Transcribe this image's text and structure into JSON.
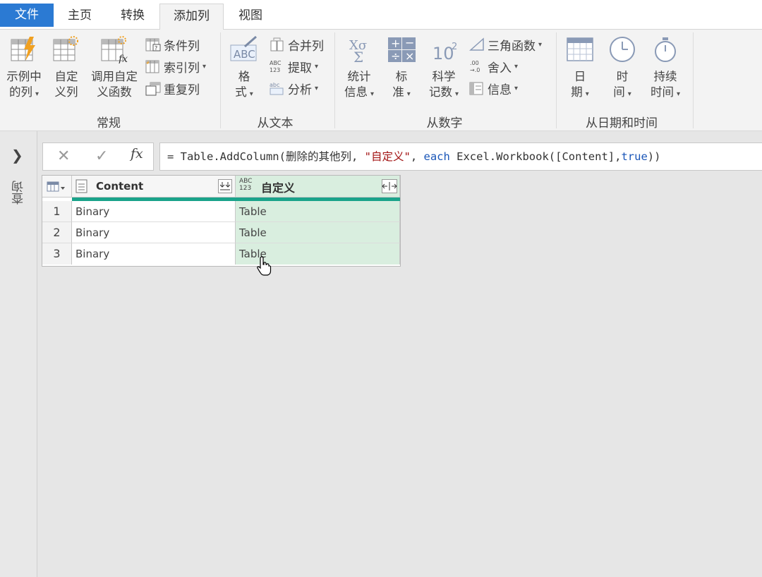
{
  "menu": {
    "file": "文件",
    "home": "主页",
    "transform": "转换",
    "add_column": "添加列",
    "view": "视图"
  },
  "ribbon": {
    "general": {
      "label": "常规",
      "example_column": [
        "示例中",
        "的列"
      ],
      "custom_column": [
        "自定",
        "义列"
      ],
      "invoke_custom_function": [
        "调用自定",
        "义函数"
      ],
      "conditional_column": "条件列",
      "index_column": "索引列",
      "duplicate_column": "重复列"
    },
    "from_text": {
      "label": "从文本",
      "format": [
        "格",
        "式"
      ],
      "merge_columns": "合并列",
      "extract": "提取",
      "parse": "分析"
    },
    "from_number": {
      "label": "从数字",
      "statistics": [
        "统计",
        "信息"
      ],
      "standard": [
        "标",
        "准"
      ],
      "scientific": [
        "科学",
        "记数"
      ],
      "trigonometry": "三角函数",
      "rounding": "舍入",
      "information": "信息"
    },
    "from_datetime": {
      "label": "从日期和时间",
      "date": [
        "日",
        "期"
      ],
      "time": [
        "时",
        "间"
      ],
      "duration": [
        "持续",
        "时间"
      ]
    }
  },
  "left_pane": {
    "label": "查询"
  },
  "formula_bar": {
    "cancel": "✕",
    "confirm": "✓",
    "fx": "fx",
    "p1": "= Table.AddColumn(删除的其他列, ",
    "p2": "\"自定义\"",
    "p3": ", ",
    "p4": "each",
    "p5": " Excel.Workbook([Content],",
    "p6": "true",
    "p7": "))"
  },
  "grid": {
    "columns": [
      {
        "name": "Content",
        "type_icon": "list-type-icon"
      },
      {
        "name": "自定义",
        "type_icon": "ABC\n123"
      }
    ],
    "type_abc": "ABC",
    "type_123": "123",
    "rows": [
      {
        "num": "1",
        "content": "Binary",
        "custom": "Table"
      },
      {
        "num": "2",
        "content": "Binary",
        "custom": "Table"
      },
      {
        "num": "3",
        "content": "Binary",
        "custom": "Table"
      }
    ]
  },
  "colors": {
    "file_tab": "#2b7ad3",
    "accent_bar": "#1aa38a",
    "selected_column": "#d9eedf",
    "keyword": "#1a56b8",
    "string": "#a31515"
  }
}
